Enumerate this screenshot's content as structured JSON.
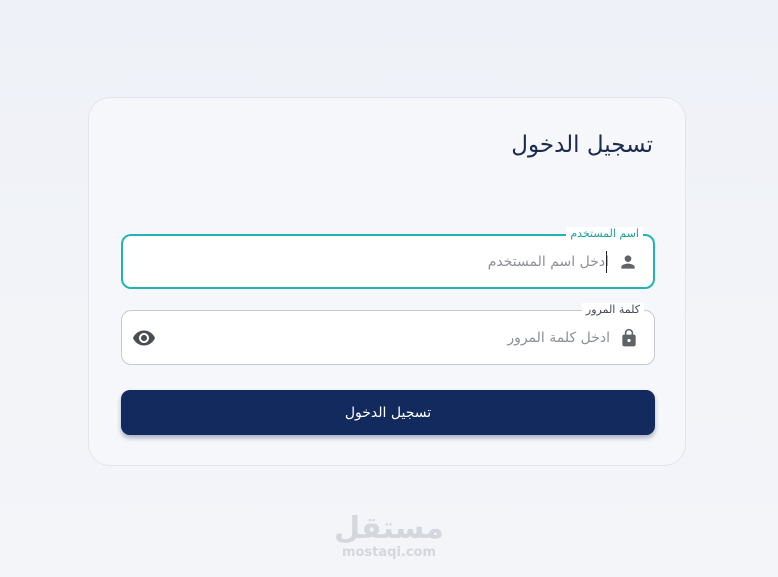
{
  "login": {
    "title": "تسجيل الدخول",
    "username": {
      "label": "اسم المستخدم",
      "placeholder": "ادخل اسم المستخدم",
      "value": "",
      "icon": "person-icon"
    },
    "password": {
      "label": "كلمة المرور",
      "placeholder": "ادخل كلمة المرور",
      "value": "",
      "icon": "lock-icon",
      "toggle_icon": "eye-icon"
    },
    "submit_label": "تسجيل الدخول"
  },
  "watermark": {
    "arabic": "مستقل",
    "latin": "mostaqi.com"
  },
  "colors": {
    "primary": "#132a5e",
    "focus": "#22b3b5",
    "title": "#1b2a4e"
  }
}
